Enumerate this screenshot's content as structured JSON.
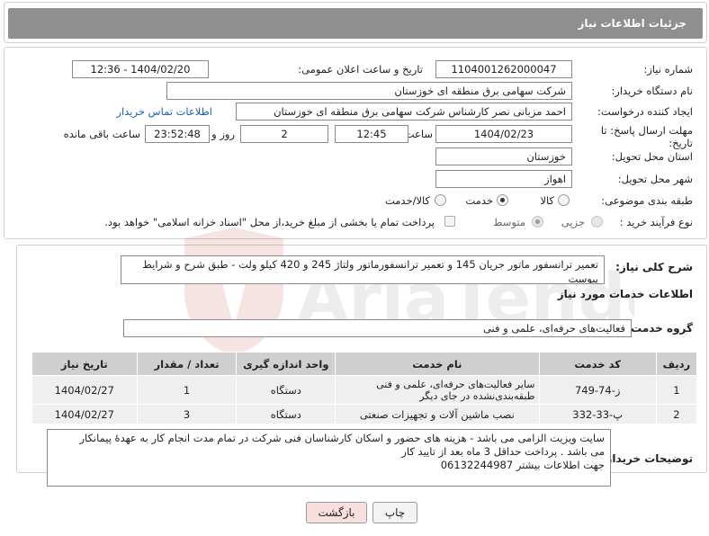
{
  "header": {
    "title": "جزئیات اطلاعات نیاز"
  },
  "form": {
    "need_number": {
      "label": "شماره نیاز:",
      "value": "1104001262000047"
    },
    "announce": {
      "label": "تاریخ و ساعت اعلان عمومی:",
      "value": "1404/02/20 - 12:36"
    },
    "buyer_org": {
      "label": "نام دستگاه خریدار:",
      "value": "شرکت سهامی برق منطقه ای خوزستان"
    },
    "creator": {
      "label": "ایجاد کننده درخواست:",
      "value": "احمد مزبانی نصر کارشناس شرکت سهامی برق منطقه ای خوزستان",
      "contact_link": "اطلاعات تماس خریدار"
    },
    "deadline": {
      "label": "مهلت ارسال پاسخ: تا تاریخ:",
      "date": "1404/02/23",
      "time_label": "ساعت",
      "time": "12:45",
      "days": "2",
      "days_label": "روز و",
      "remaining": "23:52:48",
      "remaining_label": "ساعت باقی مانده"
    },
    "province": {
      "label": "استان محل تحویل:",
      "value": "خوزستان"
    },
    "city": {
      "label": "شهر محل تحویل:",
      "value": "اهواز"
    },
    "category": {
      "label": "طبقه بندی موضوعی:",
      "options": [
        "کالا",
        "خدمت",
        "کالا/خدمت"
      ],
      "selected": "خدمت"
    },
    "process": {
      "label": "نوع فرآیند خرید :",
      "options": [
        "جزیی",
        "متوسط"
      ],
      "selected": "متوسط",
      "payment_note": "پرداخت تمام یا بخشی از مبلغ خرید،از محل \"اسناد خزانه اسلامی\" خواهد بود."
    }
  },
  "summary": {
    "label": "شرح کلی نیاز:",
    "value": "تعمیر ترانسفور ماتور جریان 145 و تعمیر ترانسفورماتور ولتاژ 245 و 420 کیلو ولت - طبق شرح و شرایط پیوست"
  },
  "services": {
    "section_title": "اطلاعات خدمات مورد نیاز",
    "group_label": "گروه خدمت:",
    "group_value": "فعالیت‌های حرفه‌ای، علمی و فنی",
    "columns": [
      "ردیف",
      "کد خدمت",
      "نام خدمت",
      "واحد اندازه گیری",
      "تعداد / مقدار",
      "تاریخ نیاز"
    ],
    "rows": [
      {
        "index": "1",
        "code": "ز-74-749",
        "name": "سایر فعالیت‌های حرفه‌ای، علمی و فنی طبقه‌بندی‌نشده در جای دیگر",
        "unit": "دستگاه",
        "qty": "1",
        "date": "1404/02/27"
      },
      {
        "index": "2",
        "code": "پ-33-332",
        "name": "نصب ماشین آلات و تجهیزات صنعتی",
        "unit": "دستگاه",
        "qty": "3",
        "date": "1404/02/27"
      }
    ]
  },
  "buyer_notes": {
    "label": "توضیحات خریدار:",
    "lines": [
      "سایت ویزیت الزامی می باشد - هزینه های حضور و اسکان کارشناسان فنی شرکت در تمام مدت انجام کار به عهدهٔ پیمانکار",
      "می باشد . پرداخت حداقل 3 ماه بعد از تایید کار",
      "جهت اطلاعات بیشتر 06132244987"
    ]
  },
  "buttons": {
    "print": "چاپ",
    "back": "بازگشت"
  },
  "watermark": {
    "text": "AriaTender.neT"
  },
  "colors": {
    "header_bg": "#8f8f8f",
    "table_header_bg": "#cfcfcf",
    "row_bg": "#efefef",
    "back_button_bg": "#f9dede",
    "link": "#1a5fb4"
  }
}
